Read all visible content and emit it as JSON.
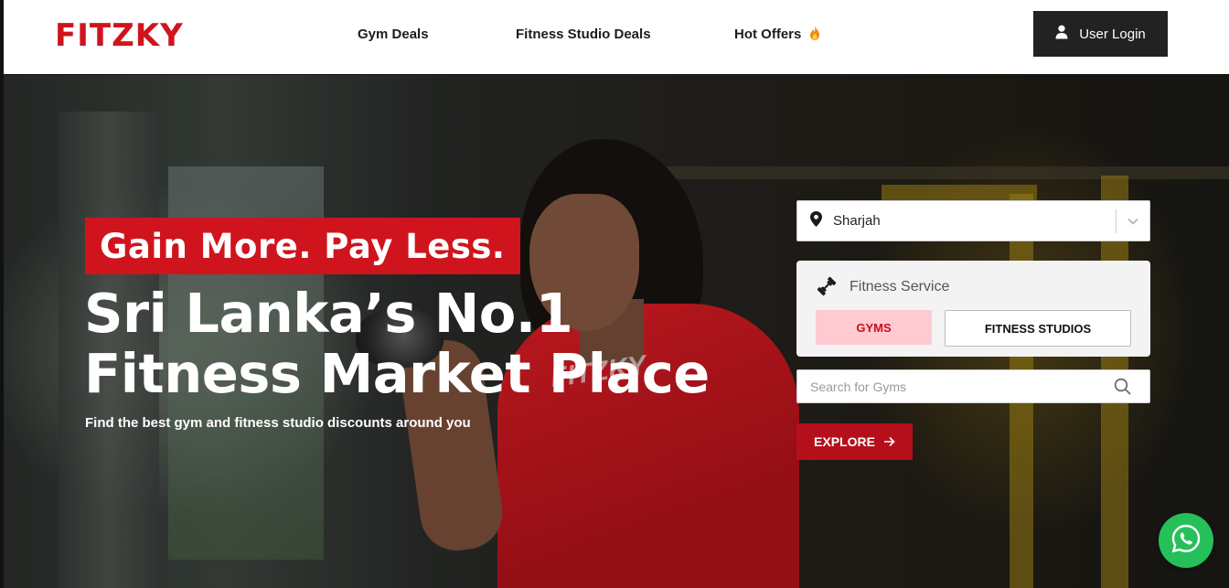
{
  "header": {
    "logo": "FITZKY",
    "nav": {
      "gym_deals": "Gym Deals",
      "fitness_studio_deals": "Fitness Studio Deals",
      "hot_offers": "Hot Offers"
    },
    "login_label": "User Login"
  },
  "hero": {
    "tagline": "Gain More. Pay Less.",
    "headline_line1": "Sri Lanka’s No.1",
    "headline_line2": "Fitness Market Place",
    "subtitle": "Find the best gym and fitness studio discounts around you"
  },
  "search_panel": {
    "location_value": "Sharjah",
    "service_label": "Fitness Service",
    "gyms_label": "GYMS",
    "studios_label": "FITNESS STUDIOS",
    "selected_service": "GYMS",
    "search_placeholder": "Search for Gyms",
    "search_value": "",
    "explore_label": "EXPLORE"
  },
  "icons": {
    "user": "user-icon",
    "flame": "flame-icon",
    "location": "location-pin-icon",
    "chevron": "chevron-down-icon",
    "service": "dumbbell-icon",
    "search": "search-icon",
    "arrow": "arrow-right-icon",
    "whatsapp": "whatsapp-icon"
  },
  "colors": {
    "brand_red": "#d0141e",
    "explore_red": "#b50f1b",
    "gyms_active_bg": "#ffcad2",
    "login_bg": "#222222",
    "whatsapp_green": "#25c05a"
  }
}
